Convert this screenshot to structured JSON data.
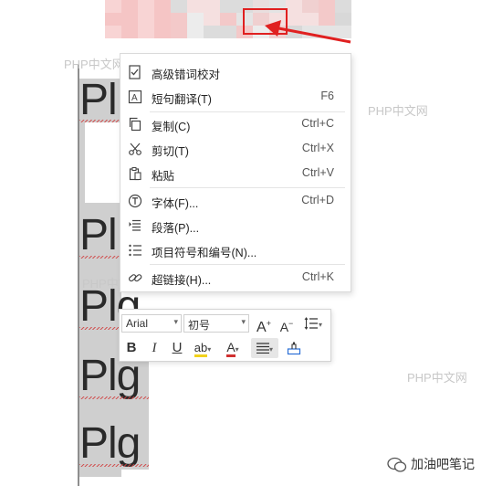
{
  "document": {
    "lines": [
      "Pl",
      "Pl",
      "Plg",
      "Plg",
      "Plg"
    ]
  },
  "watermarks": [
    "PHP中文网",
    "PHP中文网",
    "PHP中文网",
    "PHP中文网"
  ],
  "context_menu": {
    "items": [
      {
        "label": "高级错词校对",
        "shortcut": "",
        "icon": "proofread-icon"
      },
      {
        "label": "短句翻译(T)",
        "shortcut": "F6",
        "icon": "translate-icon"
      },
      {
        "label": "复制(C)",
        "shortcut": "Ctrl+C",
        "icon": "copy-icon"
      },
      {
        "label": "剪切(T)",
        "shortcut": "Ctrl+X",
        "icon": "scissors-icon"
      },
      {
        "label": "粘贴",
        "shortcut": "Ctrl+V",
        "icon": "paste-icon"
      },
      {
        "label": "字体(F)...",
        "shortcut": "Ctrl+D",
        "icon": "font-icon"
      },
      {
        "label": "段落(P)...",
        "shortcut": "",
        "icon": "paragraph-icon"
      },
      {
        "label": "项目符号和编号(N)...",
        "shortcut": "",
        "icon": "bullet-list-icon"
      },
      {
        "label": "超链接(H)...",
        "shortcut": "Ctrl+K",
        "icon": "link-icon"
      }
    ]
  },
  "mini_toolbar": {
    "font_name": "Arial",
    "font_size": "初号",
    "grow_font": "A",
    "shrink_font": "A",
    "bold": "B",
    "italic": "I",
    "underline": "U",
    "highlight": "ab",
    "font_color": "A"
  },
  "footer": {
    "account_name": "加油吧笔记"
  },
  "colors": {
    "highlight_red": "#e02020",
    "selection": "#cfcfcf",
    "font_color_underline": "#d03030",
    "highlight_yellow": "#f2d21b"
  }
}
